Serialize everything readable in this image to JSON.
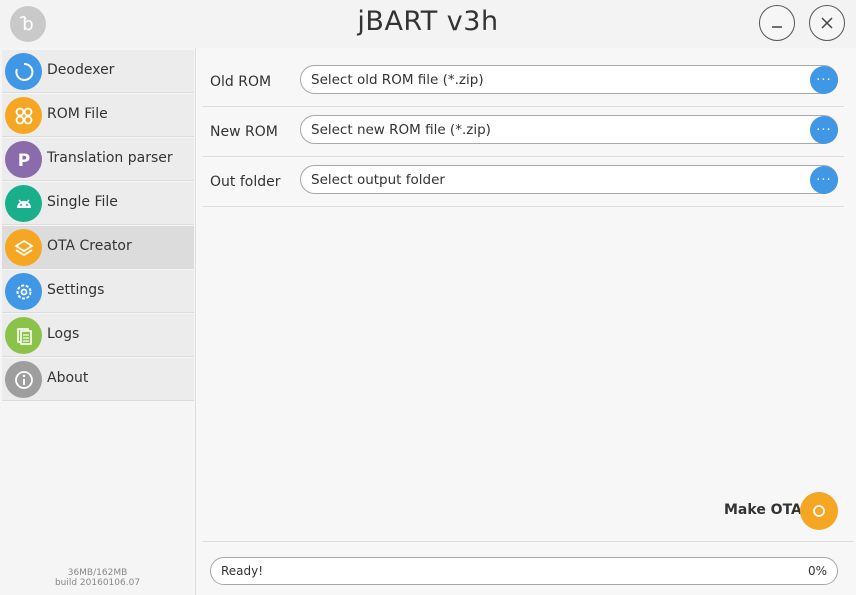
{
  "window": {
    "title": "jBART v3h",
    "logo_icon": "jbart-logo-icon",
    "minimize_icon": "minimize-icon",
    "close_icon": "close-icon"
  },
  "sidebar": {
    "items": [
      {
        "label": "Deodexer",
        "icon": "refresh-circle-icon",
        "color": "#3f97e6"
      },
      {
        "label": "ROM File",
        "icon": "four-circles-icon",
        "color": "#f5a623"
      },
      {
        "label": "Translation parser",
        "icon": "letter-p-icon",
        "color": "#8a6bab"
      },
      {
        "label": "Single File",
        "icon": "android-icon",
        "color": "#1aaf8b"
      },
      {
        "label": "OTA Creator",
        "icon": "layers-icon",
        "color": "#f5a623"
      },
      {
        "label": "Settings",
        "icon": "gear-icon",
        "color": "#3f97e6"
      },
      {
        "label": "Logs",
        "icon": "documents-icon",
        "color": "#8bc34a"
      },
      {
        "label": "About",
        "icon": "info-icon",
        "color": "#9e9e9e"
      }
    ],
    "active_index": 4,
    "memory": "36MB/162MB",
    "build": "build 20160106.07"
  },
  "main": {
    "rows": [
      {
        "label": "Old ROM",
        "placeholder": "Select old ROM file (*.zip)"
      },
      {
        "label": "New ROM",
        "placeholder": "Select new ROM file (*.zip)"
      },
      {
        "label": "Out folder",
        "placeholder": "Select output folder"
      }
    ],
    "browse_label": "···",
    "make_ota_label": "Make OTA",
    "make_ota_icon": "circle-o-icon"
  },
  "status": {
    "text": "Ready!",
    "progress": "0%"
  },
  "colors": {
    "accent_blue": "#3f97e6",
    "accent_orange": "#f5a623"
  }
}
